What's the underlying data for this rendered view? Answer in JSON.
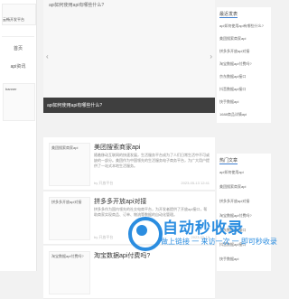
{
  "sidebar": {
    "logo_text": "云畅开发平台",
    "nav": [
      "首页",
      "api资讯"
    ],
    "banner_text": "banner"
  },
  "slider": {
    "caption_top": "api如何使用api有哪些什么?",
    "caption": "api如何使用api有哪些什么?",
    "prev": "‹",
    "next": "›"
  },
  "articles": [
    {
      "thumb": "美团搜索商家api",
      "title": "美团搜索商家api",
      "desc": "随着移动互联网的快速发展，生活服务平台成为了人们日常生活中不可或缺的一部分。美团作为中国领先的生活服务电子商务平台，为广大用户提供了一站式本地生活服务。",
      "meta": "by 开放平台",
      "date": "2023-05-13 12:41"
    },
    {
      "thumb": "拼多多开放api对接",
      "title": "拼多多开放api对接",
      "desc": "拼多多作为国内领先的社交电商平台，为开发者提供了开放api接口，帮助商家实现商品、订单、物流等数据的自动化管理。",
      "meta": "by 开放平台",
      "date": "2023-05-13"
    },
    {
      "thumb": "淘宝数据api付费吗?",
      "title": "淘宝数据api付费吗?",
      "desc": "",
      "meta": "",
      "date": ""
    }
  ],
  "right": {
    "latest_title": "最近发表",
    "latest": [
      "api如何使用api有哪些什么?",
      "美团搜索商家api",
      "拼多多开放api对接",
      "淘宝数据api付费吗?",
      "京东数据api接口",
      "抖音数据api接口",
      "快手数据api",
      "1688商品详情api"
    ],
    "hot_title": "热门文章",
    "hot": [
      "api如何使用api",
      "美团搜索商家api",
      "拼多多开放api对接",
      "淘宝数据api付费吗?",
      "京东数据api接口",
      "抖音数据api接口",
      "快手数据api"
    ]
  },
  "watermark": {
    "title": "自动秒收录",
    "sub": "做上链接 一 来访一次 一 即可秒收录"
  },
  "colors": {
    "accent": "#2b8de0",
    "slider_bar": "#3f3f3f"
  }
}
